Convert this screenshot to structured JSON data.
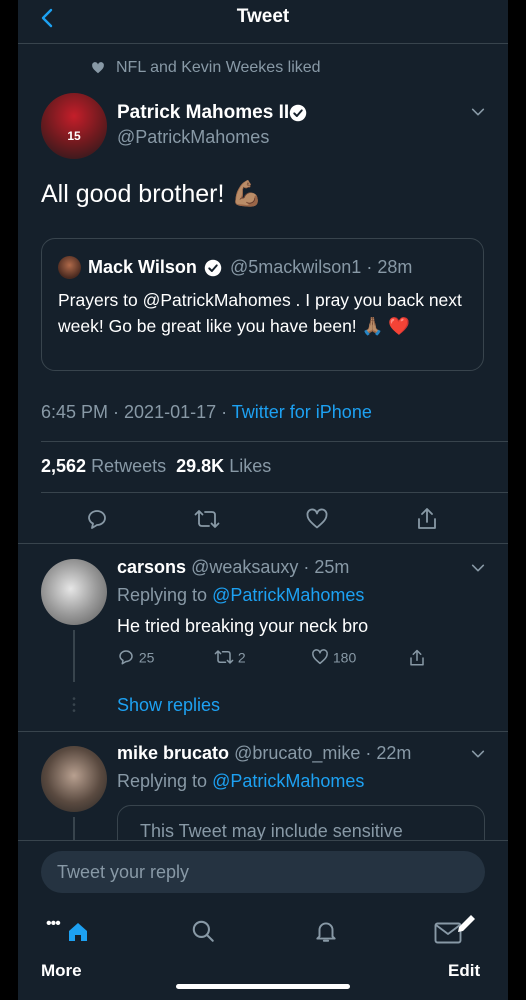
{
  "header": {
    "title": "Tweet",
    "back_icon": "chevron-left-icon"
  },
  "social_context": {
    "text": "NFL and Kevin Weekes liked"
  },
  "tweet": {
    "display_name": "Patrick Mahomes II",
    "handle": "@PatrickMahomes",
    "text": "All good brother! 💪🏽",
    "timestamp": "6:45 PM · 2021-01-17 · ",
    "source": "Twitter for iPhone",
    "retweets_count": "2,562",
    "retweets_label": "Retweets",
    "likes_count": "29.8K",
    "likes_label": "Likes",
    "quoted": {
      "display_name": "Mack Wilson",
      "handle_time": "@5mackwilson1 · 28m",
      "text": "Prayers to @PatrickMahomes . I pray you back next week! Go be great like you have been! 🙏🏽 ❤️"
    }
  },
  "replies": [
    {
      "display_name": "carsons",
      "handle_time": "@weaksauxy · 25m",
      "replying_prefix": "Replying to ",
      "replying_to": "@PatrickMahomes",
      "text": "He tried breaking your neck bro",
      "reply_count": "25",
      "retweet_count": "2",
      "like_count": "180",
      "show_replies": "Show replies"
    },
    {
      "display_name": "mike brucato",
      "handle_time": "@brucato_mike · 22m",
      "replying_prefix": "Replying to ",
      "replying_to": "@PatrickMahomes",
      "sensitive_notice": "This Tweet may include sensitive"
    }
  ],
  "composer": {
    "placeholder": "Tweet your reply"
  },
  "bottom_nav": {
    "more_label": "More",
    "edit_label": "Edit"
  },
  "colors": {
    "background": "#15202b",
    "accent": "#1da1f2",
    "secondary_text": "#8899a6",
    "divider": "#38444d"
  }
}
